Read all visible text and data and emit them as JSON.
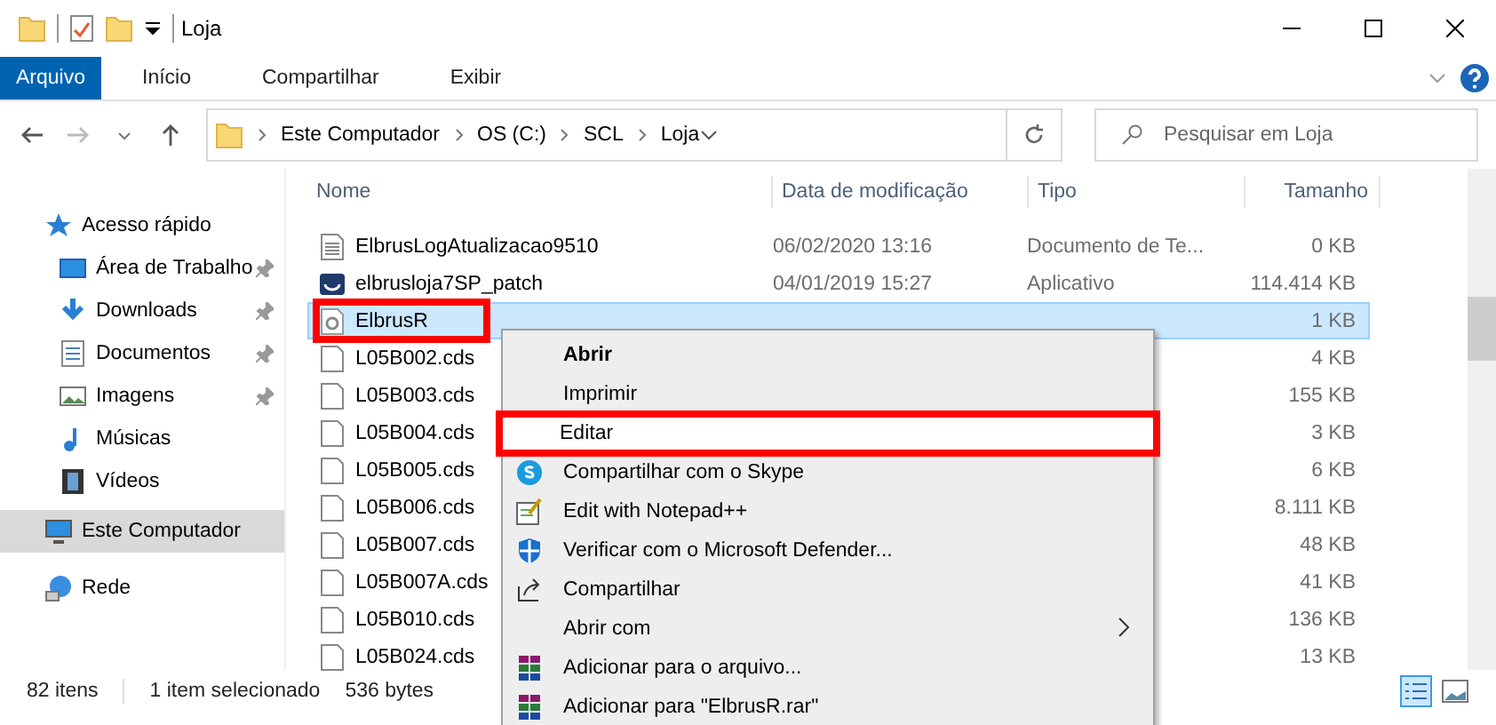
{
  "window": {
    "title": "Loja"
  },
  "ribbon": {
    "tabs": [
      {
        "label": "Arquivo",
        "selected": true
      },
      {
        "label": "Início",
        "selected": false
      },
      {
        "label": "Compartilhar",
        "selected": false
      },
      {
        "label": "Exibir",
        "selected": false
      }
    ]
  },
  "address_bar": {
    "path": [
      "Este Computador",
      "OS (C:)",
      "SCL",
      "Loja"
    ]
  },
  "search": {
    "placeholder": "Pesquisar em Loja"
  },
  "sidebar": {
    "items": [
      {
        "label": "Acesso rápido",
        "pinned": false,
        "selected": false
      },
      {
        "label": "Área de Trabalho",
        "pinned": true,
        "selected": false
      },
      {
        "label": "Downloads",
        "pinned": true,
        "selected": false
      },
      {
        "label": "Documentos",
        "pinned": true,
        "selected": false
      },
      {
        "label": "Imagens",
        "pinned": true,
        "selected": false
      },
      {
        "label": "Músicas",
        "pinned": false,
        "selected": false
      },
      {
        "label": "Vídeos",
        "pinned": false,
        "selected": false
      },
      {
        "label": "Este Computador",
        "pinned": false,
        "selected": true
      },
      {
        "label": "Rede",
        "pinned": false,
        "selected": false
      }
    ]
  },
  "table": {
    "columns": [
      "Nome",
      "Data de modificação",
      "Tipo",
      "Tamanho"
    ],
    "rows": [
      {
        "name": "ElbrusLogAtualizacao9510",
        "date": "06/02/2020 13:16",
        "type": "Documento de Te...",
        "size": "0 KB",
        "kind": "text",
        "selected": false,
        "highlight": false
      },
      {
        "name": "elbrusloja7SP_patch",
        "date": "04/01/2019 15:27",
        "type": "Aplicativo",
        "size": "114.414 KB",
        "kind": "app",
        "selected": false,
        "highlight": false
      },
      {
        "name": "ElbrusR",
        "size": "1 KB",
        "kind": "config",
        "selected": true,
        "highlight": true
      },
      {
        "name": "L05B002.cds",
        "size": "4 KB",
        "kind": "file",
        "selected": false,
        "highlight": false
      },
      {
        "name": "L05B003.cds",
        "size": "155 KB",
        "kind": "file",
        "selected": false,
        "highlight": false
      },
      {
        "name": "L05B004.cds",
        "size": "3 KB",
        "kind": "file",
        "selected": false,
        "highlight": false
      },
      {
        "name": "L05B005.cds",
        "size": "6 KB",
        "kind": "file",
        "selected": false,
        "highlight": false
      },
      {
        "name": "L05B006.cds",
        "size": "8.111 KB",
        "kind": "file",
        "selected": false,
        "highlight": false
      },
      {
        "name": "L05B007.cds",
        "size": "48 KB",
        "kind": "file",
        "selected": false,
        "highlight": false
      },
      {
        "name": "L05B007A.cds",
        "size": "41 KB",
        "kind": "file",
        "selected": false,
        "highlight": false
      },
      {
        "name": "L05B010.cds",
        "size": "136 KB",
        "kind": "file",
        "selected": false,
        "highlight": false
      },
      {
        "name": "L05B024.cds",
        "size": "13 KB",
        "kind": "file",
        "selected": false,
        "highlight": false
      }
    ]
  },
  "context_menu": {
    "items": [
      {
        "label": "Abrir",
        "kind": "plain",
        "bold": true,
        "highlight": false,
        "submenu": false
      },
      {
        "label": "Imprimir",
        "kind": "plain",
        "bold": false,
        "highlight": false,
        "submenu": false
      },
      {
        "label": "Editar",
        "kind": "plain",
        "bold": false,
        "highlight": true,
        "submenu": false
      },
      {
        "label": "Compartilhar com o Skype",
        "kind": "skype",
        "bold": false,
        "highlight": false,
        "submenu": false
      },
      {
        "label": "Edit with Notepad++",
        "kind": "notepad",
        "bold": false,
        "highlight": false,
        "submenu": false
      },
      {
        "label": "Verificar com o Microsoft Defender...",
        "kind": "shield",
        "bold": false,
        "highlight": false,
        "submenu": false
      },
      {
        "label": "Compartilhar",
        "kind": "share",
        "bold": false,
        "highlight": false,
        "submenu": false
      },
      {
        "label": "Abrir com",
        "kind": "plain",
        "bold": false,
        "highlight": false,
        "submenu": true
      },
      {
        "label": "Adicionar para o arquivo...",
        "kind": "archive",
        "bold": false,
        "highlight": false,
        "submenu": false
      },
      {
        "label": "Adicionar para \"ElbrusR.rar\"",
        "kind": "archive",
        "bold": false,
        "highlight": false,
        "submenu": false
      }
    ]
  },
  "status_bar": {
    "count": "82 itens",
    "selection": "1 item selecionado",
    "size": "536 bytes"
  }
}
